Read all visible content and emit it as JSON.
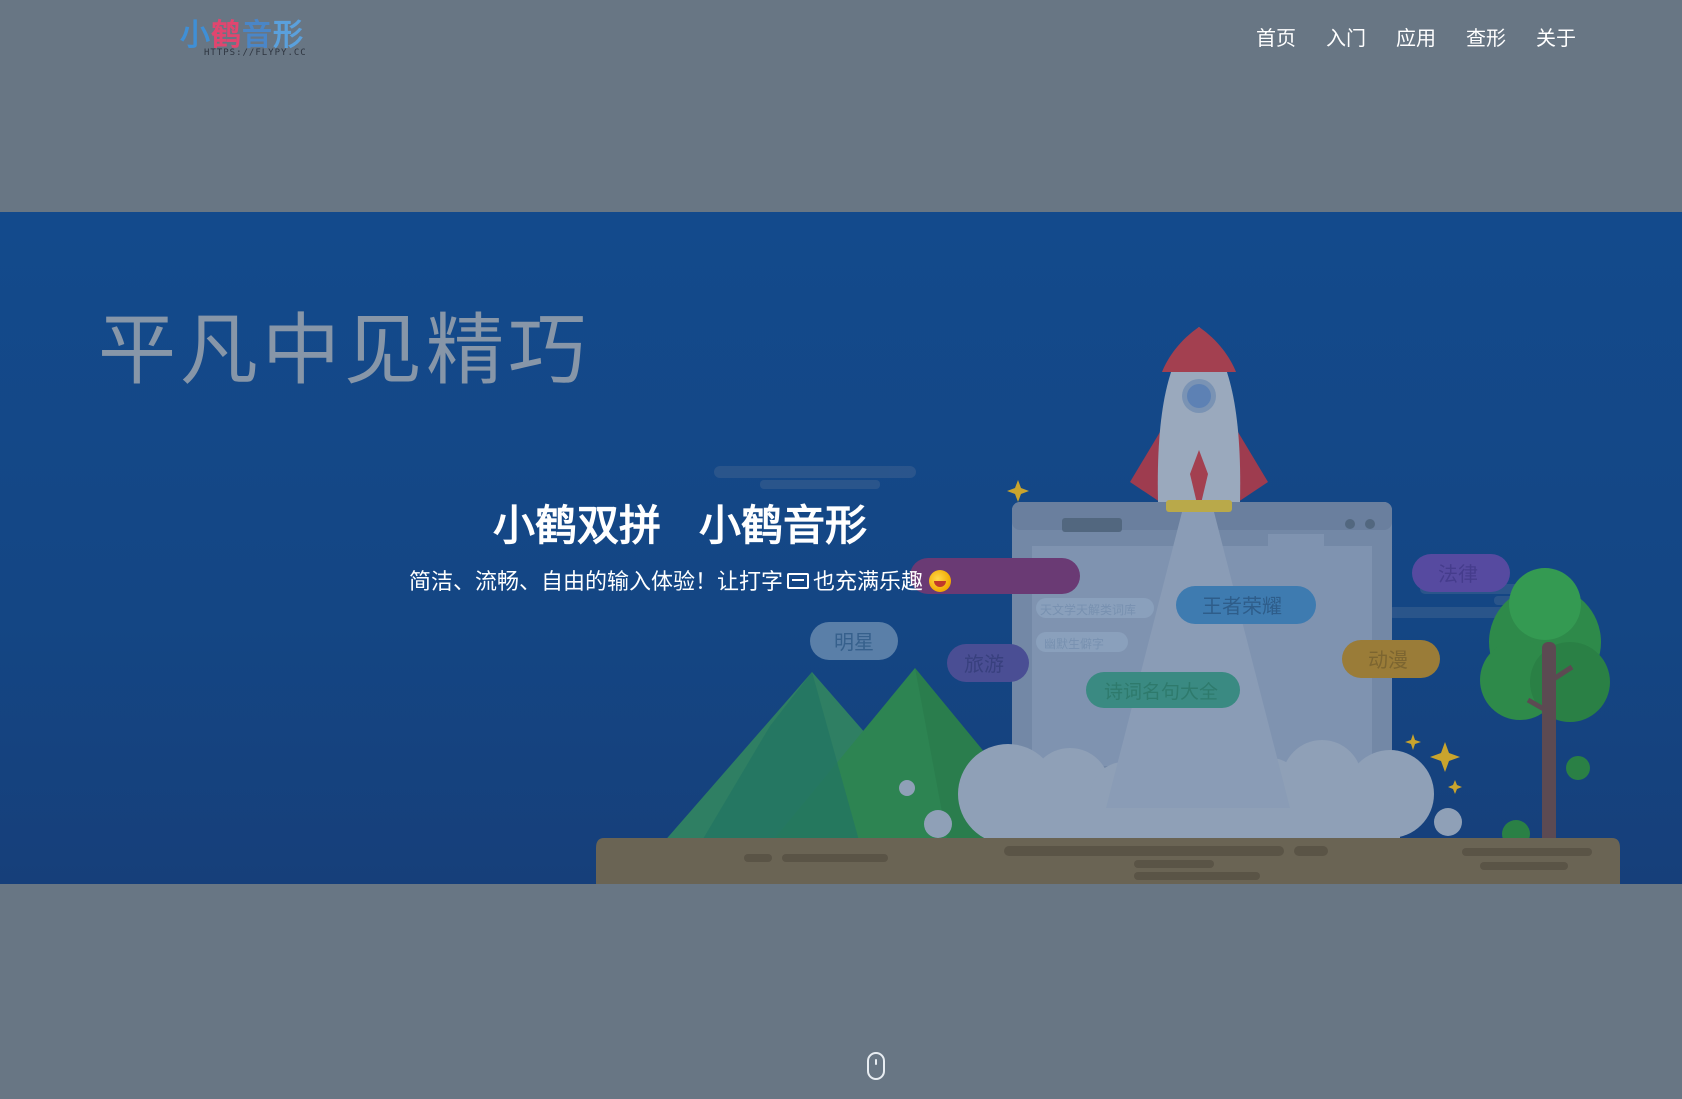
{
  "header": {
    "logo": {
      "main": [
        "小",
        "鹤",
        "音",
        "形"
      ],
      "sub": "HTTPS://FLYPY.CC"
    },
    "nav": [
      {
        "label": "首页"
      },
      {
        "label": "入门"
      },
      {
        "label": "应用"
      },
      {
        "label": "查形"
      },
      {
        "label": "关于"
      }
    ]
  },
  "hero": {
    "slogan": "平凡中见精巧",
    "title_left": "小鹤双拼",
    "title_right": "小鹤音形",
    "subtitle_part1": "简洁、流畅、自由的输入体验！让打字",
    "subtitle_icon1": "keyboard-icon",
    "subtitle_part2": "也充满乐趣",
    "subtitle_icon2": "rofl-emoji-icon",
    "tags": {
      "mingxing": "明星",
      "lvyou": "旅游",
      "shici": "诗词名句大全",
      "wangzhe": "王者荣耀",
      "falv": "法律",
      "dongman": "动漫",
      "tianwen": "天文学天解类词库",
      "shengzi": "幽默生僻字"
    }
  },
  "scroll_hint": {
    "icon": "mouse-scroll-icon"
  }
}
